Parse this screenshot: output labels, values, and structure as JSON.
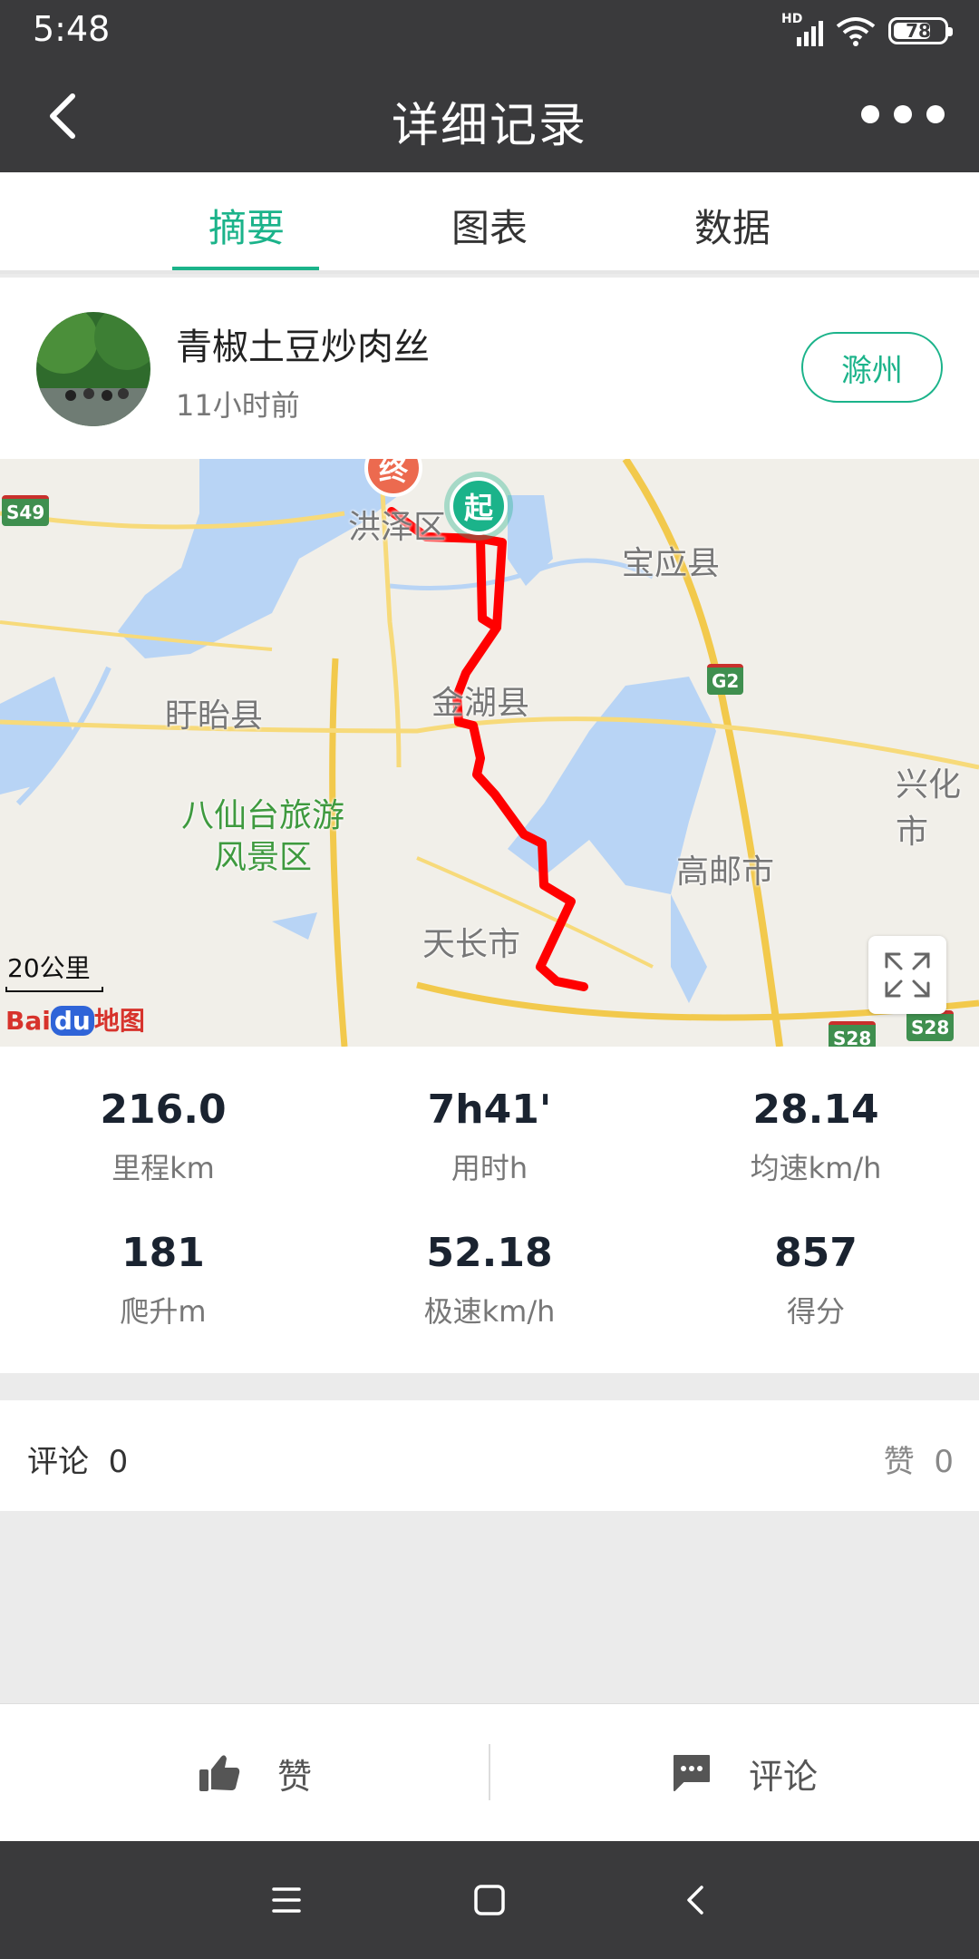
{
  "status_bar": {
    "time": "5:48",
    "network": "HD",
    "battery": "78"
  },
  "header": {
    "title": "详细记录"
  },
  "tabs": [
    {
      "label": "摘要",
      "active": true
    },
    {
      "label": "图表",
      "active": false
    },
    {
      "label": "数据",
      "active": false
    }
  ],
  "profile": {
    "name": "青椒土豆炒肉丝",
    "time_ago": "11小时前",
    "city": "滁州"
  },
  "map": {
    "labels": [
      "洪泽区",
      "宝应县",
      "盱眙县",
      "金湖县",
      "八仙台旅游",
      "风景区",
      "兴化市",
      "高邮市",
      "天长市"
    ],
    "roads": [
      "S49",
      "G2",
      "S28",
      "S28"
    ],
    "pins": {
      "start": "起",
      "end": "终"
    },
    "scale": "20公里",
    "provider": {
      "bai": "Bai",
      "du": "du",
      "suffix": "地图"
    }
  },
  "stats": [
    {
      "value": "216.0",
      "label": "里程km"
    },
    {
      "value": "7h41'",
      "label": "用时h"
    },
    {
      "value": "28.14",
      "label": "均速km/h"
    },
    {
      "value": "181",
      "label": "爬升m"
    },
    {
      "value": "52.18",
      "label": "极速km/h"
    },
    {
      "value": "857",
      "label": "得分"
    }
  ],
  "comments": {
    "label": "评论",
    "count": "0",
    "like_label": "赞",
    "like_count": "0"
  },
  "actions": {
    "like": "赞",
    "comment": "评论"
  },
  "colors": {
    "accent": "#1bb38a",
    "route": "#ff0000",
    "header_bg": "#3a3a3c"
  }
}
